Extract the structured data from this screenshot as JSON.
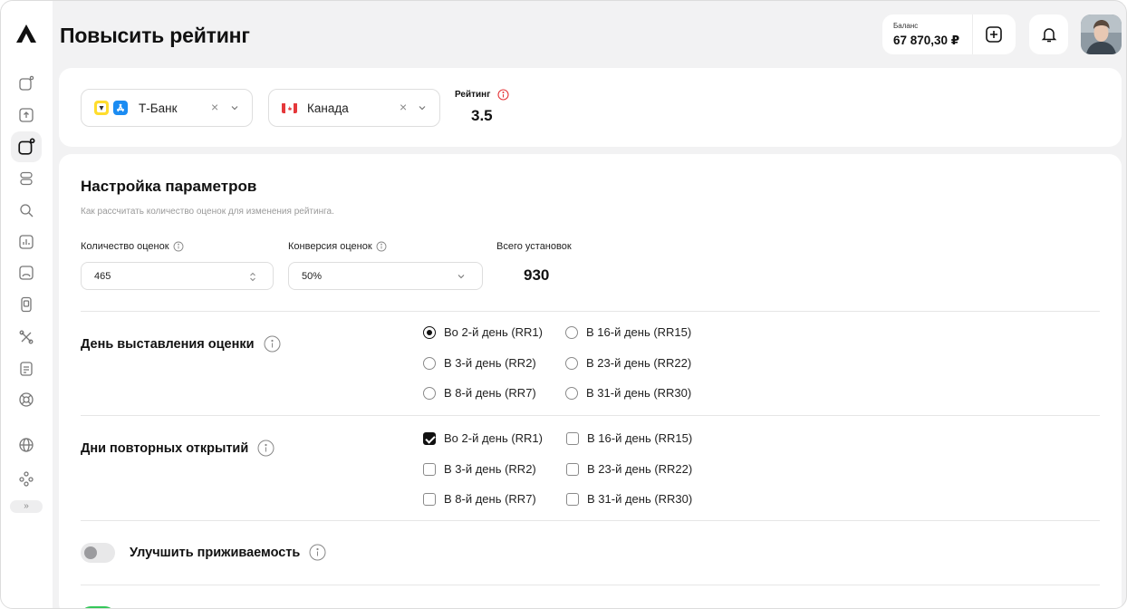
{
  "header": {
    "title": "Повысить рейтинг",
    "balance_label": "Баланс",
    "balance_value": "67 870,30 ₽"
  },
  "sidebar": {
    "items": [
      "apps-icon",
      "upload-icon",
      "apps-icon-active",
      "server-icon",
      "search-icon",
      "stats-icon",
      "store-icon",
      "device-icon",
      "tools-icon",
      "document-icon",
      "support-icon",
      "globe-icon",
      "team-icon"
    ],
    "expand_label": "»"
  },
  "filters": {
    "app": {
      "label": "Т-Банк",
      "icons": [
        "tbank-icon",
        "appstore-icon"
      ]
    },
    "country": {
      "label": "Канада",
      "flag": "canada-flag-icon"
    },
    "rating_label": "Рейтинг",
    "rating_value": "3.5"
  },
  "settings": {
    "title": "Настройка параметров",
    "subtitle": "Как рассчитать количество оценок для изменения рейтинга.",
    "count_label": "Количество оценок",
    "count_value": "465",
    "conversion_label": "Конверсия оценок",
    "conversion_value": "50%",
    "total_label": "Всего установок",
    "total_value": "930"
  },
  "rating_day": {
    "title": "День выставления оценки",
    "options": [
      {
        "label": "Во 2-й день (RR1)",
        "selected": true
      },
      {
        "label": "В 3-й день (RR2)",
        "selected": false
      },
      {
        "label": "В 8-й день (RR7)",
        "selected": false
      },
      {
        "label": "В 16-й день (RR15)",
        "selected": false
      },
      {
        "label": "В 23-й день (RR22)",
        "selected": false
      },
      {
        "label": "В 31-й день (RR30)",
        "selected": false
      }
    ]
  },
  "reopen_days": {
    "title": "Дни повторных открытий",
    "options": [
      {
        "label": "Во 2-й день (RR1)",
        "checked": true
      },
      {
        "label": "В 3-й день (RR2)",
        "checked": false
      },
      {
        "label": "В 8-й день (RR7)",
        "checked": false
      },
      {
        "label": "В 16-й день (RR15)",
        "checked": false
      },
      {
        "label": "В 23-й день (RR22)",
        "checked": false
      },
      {
        "label": "В 31-й день (RR30)",
        "checked": false
      }
    ]
  },
  "retention": {
    "label": "Улучшить приживаемость",
    "enabled": false
  },
  "colors": {
    "background": "#f2f2f3",
    "card": "#ffffff",
    "accent_red": "#e5383b",
    "toggle_on": "#34c759"
  }
}
